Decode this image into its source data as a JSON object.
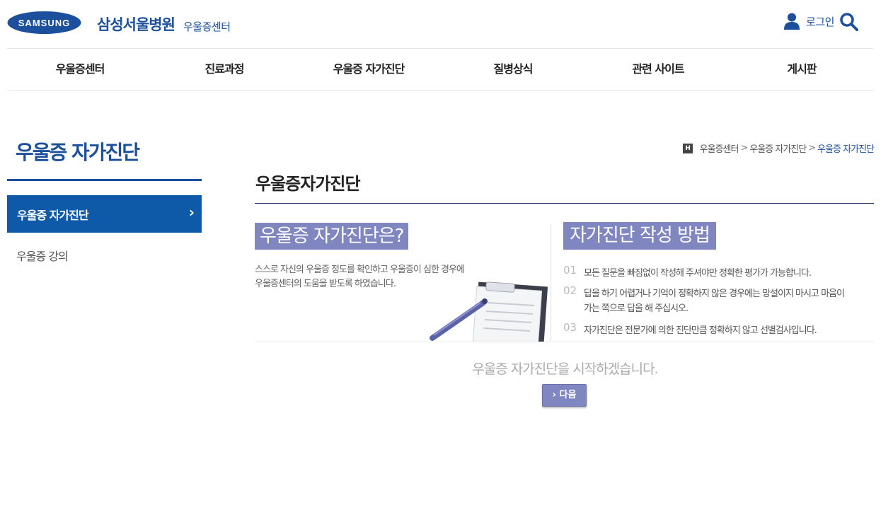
{
  "header": {
    "brand_logo_text": "SAMSUNG",
    "hospital_name": "삼성서울병원",
    "center_name": "우울증센터",
    "login_label": "로그인"
  },
  "gnb": {
    "items": [
      {
        "label": "우울증센터"
      },
      {
        "label": "진료과정"
      },
      {
        "label": "우울증 자가진단"
      },
      {
        "label": "질병상식"
      },
      {
        "label": "관련 사이트"
      },
      {
        "label": "게시판"
      }
    ]
  },
  "sidebar": {
    "title": "우울증 자가진단",
    "items": [
      {
        "label": "우울증 자가진단",
        "active": true,
        "chevron": "›"
      },
      {
        "label": "우울증 강의",
        "active": false
      }
    ]
  },
  "breadcrumb": {
    "home_icon_text": "H",
    "items": [
      "우울증센터",
      "우울증 자가진단",
      "우울증 자가진단"
    ],
    "separator": ">"
  },
  "content": {
    "title": "우울증자가진단",
    "intro": {
      "heading": "우울증 자가진단은?",
      "lines": [
        "스스로 자신의 우울증 정도를 확인하고 우울증이 심한 경우에",
        "우울증센터의 도움을 받도록 하였습니다."
      ]
    },
    "method": {
      "heading": "자가진단 작성 방법",
      "steps": [
        {
          "num": "01",
          "lines": [
            "모든 질문을 빠짐없이 작성해 주셔야만 정확한 평가가 가능합니다."
          ]
        },
        {
          "num": "02",
          "lines": [
            "답을 하기 어렵거나 기억이 정확하지 않은 경우에는 망설이지 마시고 마음이",
            "가는 쪽으로 답을 해 주십시오."
          ]
        },
        {
          "num": "03",
          "lines": [
            "자가진단은 전문가에 의한 진단만큼 정확하지 않고 선별검사입니다."
          ]
        }
      ]
    },
    "start_text": "우울증 자가진단을 시작하겠습니다.",
    "next_button": {
      "arrow": "›",
      "label": "다음"
    }
  },
  "colors": {
    "brand_blue": "#1c4f9c",
    "active_menu": "#0f5aa8",
    "accent_purple": "#7f86c0"
  }
}
